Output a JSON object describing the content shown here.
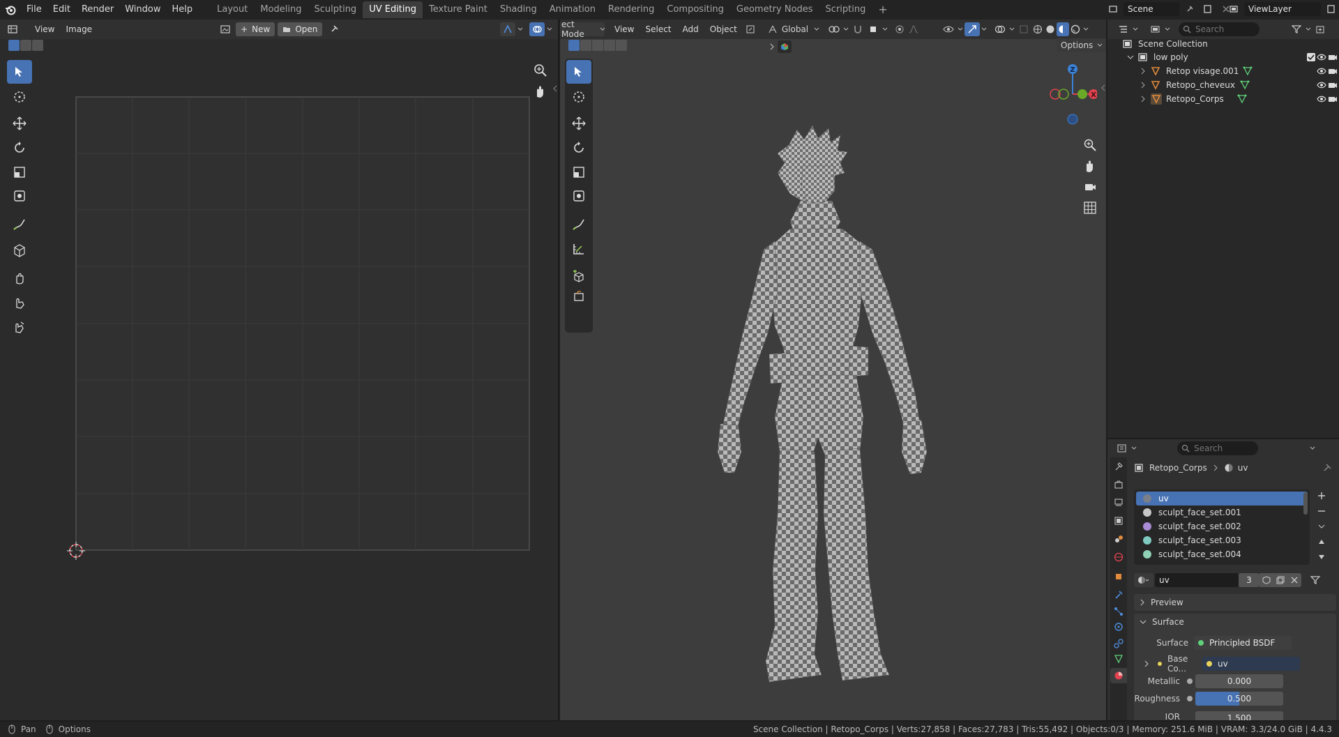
{
  "topbar": {
    "menus": [
      "File",
      "Edit",
      "Render",
      "Window",
      "Help"
    ],
    "workspaces": [
      "Layout",
      "Modeling",
      "Sculpting",
      "UV Editing",
      "Texture Paint",
      "Shading",
      "Animation",
      "Rendering",
      "Compositing",
      "Geometry Nodes",
      "Scripting"
    ],
    "active_workspace": "UV Editing",
    "add_tab": "+",
    "scene": "Scene",
    "view_layer": "ViewLayer"
  },
  "image_editor": {
    "menus": [
      "View",
      "Image"
    ],
    "new_label": "New",
    "open_label": "Open"
  },
  "viewport": {
    "mode": "ect Mode",
    "menus": [
      "View",
      "Select",
      "Add",
      "Object"
    ],
    "transform_orientation": "Global",
    "options_label": "Options",
    "gizmo": {
      "z": "Z",
      "x": "X"
    }
  },
  "outliner": {
    "search_placeholder": "Search",
    "root": "Scene Collection",
    "collection": "low poly",
    "objects": [
      "Retop visage.001",
      "Retopo_cheveux",
      "Retopo_Corps"
    ]
  },
  "properties": {
    "search_placeholder": "Search",
    "breadcrumb": [
      "Retopo_Corps",
      "uv"
    ],
    "materials": [
      {
        "name": "uv",
        "color": "#7a7f8a"
      },
      {
        "name": "sculpt_face_set.001",
        "color": "#c8c8c8"
      },
      {
        "name": "sculpt_face_set.002",
        "color": "#a98bd6"
      },
      {
        "name": "sculpt_face_set.003",
        "color": "#7fc9c0"
      },
      {
        "name": "sculpt_face_set.004",
        "color": "#8fd0b5"
      }
    ],
    "selected_material": "uv",
    "material_name": "uv",
    "users": "3",
    "sections": {
      "preview": "Preview",
      "surface": "Surface"
    },
    "surface_label": "Surface",
    "surface_value": "Principled BSDF",
    "base_color_label": "Base Co...",
    "base_color_value": "uv",
    "metallic_label": "Metallic",
    "metallic_value": "0.000",
    "roughness_label": "Roughness",
    "roughness_value": "0.500",
    "roughness_fraction": 0.5,
    "ior_label": "IOR",
    "ior_value": "1.500"
  },
  "statusbar": {
    "left_pan": "Pan",
    "left_options": "Options",
    "info": "Scene Collection | Retopo_Corps | Verts:27,858 | Faces:27,783 | Tris:55,492 | Objects:0/3 | Memory: 251.6 MiB | VRAM: 3.3/24.0 GiB | 4.4.3"
  },
  "colors": {
    "accent": "#4772b3",
    "axis_x": "#e0434f",
    "axis_y": "#6aa828",
    "axis_z": "#3b82d8"
  }
}
